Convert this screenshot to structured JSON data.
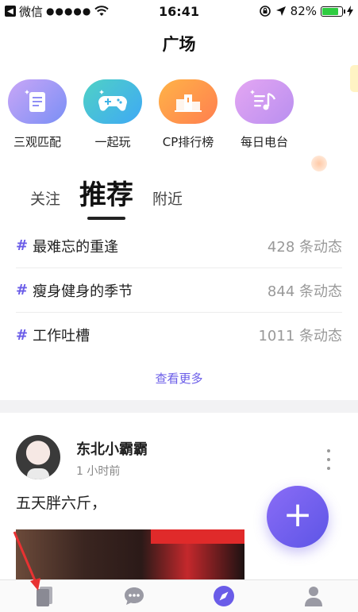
{
  "status_bar": {
    "back_app": "微信",
    "signal": "●●●●●",
    "time": "16:41",
    "battery_text": "82%",
    "battery_level": 0.82
  },
  "header": {
    "title": "广场"
  },
  "quick_entries": [
    {
      "label": "三观匹配",
      "icon": "checklist-icon"
    },
    {
      "label": "一起玩",
      "icon": "gamepad-icon"
    },
    {
      "label": "CP排行榜",
      "icon": "podium-icon"
    },
    {
      "label": "每日电台",
      "icon": "radio-music-icon"
    }
  ],
  "tabs": [
    {
      "label": "关注",
      "active": false
    },
    {
      "label": "推荐",
      "active": true
    },
    {
      "label": "附近",
      "active": false
    }
  ],
  "topics": [
    {
      "hash": "#",
      "name": "最难忘的重逢",
      "count": "428 条动态"
    },
    {
      "hash": "#",
      "name": "瘦身健身的季节",
      "count": "844 条动态"
    },
    {
      "hash": "#",
      "name": "工作吐槽",
      "count": "1011 条动态"
    }
  ],
  "see_more": "查看更多",
  "post": {
    "user_name": "东北小霸霸",
    "time": "1 小时前",
    "text": "五天胖六斤，"
  },
  "fab": {
    "label": "+"
  },
  "tabbar": [
    {
      "name": "feed-tab",
      "icon": "cards-icon",
      "active": true
    },
    {
      "name": "messages-tab",
      "icon": "chat-bubble-icon",
      "active": false
    },
    {
      "name": "discover-tab",
      "icon": "compass-icon",
      "active": false
    },
    {
      "name": "profile-tab",
      "icon": "person-icon",
      "active": false
    }
  ],
  "colors": {
    "accent": "#6a5ce8",
    "fab_start": "#8a6cf6",
    "fab_end": "#5d55e6",
    "annotation_arrow": "#e83232"
  }
}
